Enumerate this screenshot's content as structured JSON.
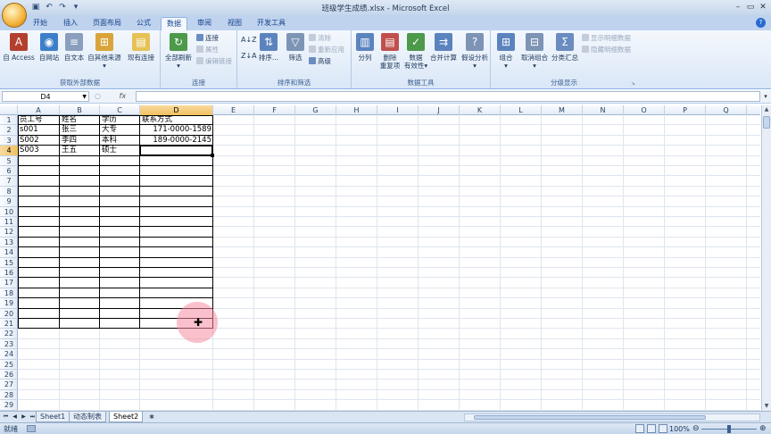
{
  "window": {
    "title": "班级学生成绩.xlsx - Microsoft Excel",
    "app_icon_letter": "X"
  },
  "ribbon_tabs": [
    "开始",
    "插入",
    "页面布局",
    "公式",
    "数据",
    "审阅",
    "视图",
    "开发工具"
  ],
  "active_tab": "数据",
  "ribbon": {
    "get_external": {
      "label": "获取外部数据",
      "access": "自 Access",
      "web": "自网站",
      "text": "自文本",
      "other": "自其他来源",
      "existing": "现有连接"
    },
    "connections": {
      "label": "连接",
      "refresh_all": "全部刷新",
      "connections": "连接",
      "properties": "属性",
      "edit_links": "编辑链接"
    },
    "sort_filter": {
      "label": "排序和筛选",
      "sort": "排序...",
      "filter": "筛选",
      "clear": "清除",
      "reapply": "重新应用",
      "advanced": "高级"
    },
    "data_tools": {
      "label": "数据工具",
      "text_to_columns": "分列",
      "remove_dup_1": "删除",
      "remove_dup_2": "重复项",
      "validation_1": "数据",
      "validation_2": "有效性",
      "consolidate": "合并计算",
      "whatif": "假设分析"
    },
    "outline": {
      "label": "分级显示",
      "group": "组合",
      "ungroup": "取消组合",
      "subtotal": "分类汇总",
      "show_detail": "显示明细数据",
      "hide_detail": "隐藏明细数据"
    }
  },
  "formula_bar": {
    "name_box": "D4",
    "fx": "fx",
    "content": ""
  },
  "columns": [
    "A",
    "B",
    "C",
    "D",
    "E",
    "F",
    "G",
    "H",
    "I",
    "J",
    "K",
    "L",
    "M",
    "N",
    "O",
    "P",
    "Q",
    "R"
  ],
  "rows": [
    "1",
    "2",
    "3",
    "4",
    "5",
    "6",
    "7",
    "8",
    "9",
    "10",
    "11",
    "12",
    "13",
    "14",
    "15",
    "16",
    "17",
    "18",
    "19",
    "20",
    "21",
    "22",
    "23",
    "24",
    "25",
    "26",
    "27",
    "28",
    "29"
  ],
  "selected": {
    "col": "D",
    "row": "4"
  },
  "cells": {
    "header": [
      "员工号",
      "姓名",
      "学历",
      "联系方式"
    ],
    "r2": [
      "s001",
      "张三",
      "大专",
      "171-0000-1589"
    ],
    "r3": [
      "S002",
      "李四",
      "本科",
      "189-0000-2145"
    ],
    "r4": [
      "S003",
      "王五",
      "硕士",
      ""
    ]
  },
  "sheets": [
    "Sheet1",
    "动态制表",
    "Sheet2"
  ],
  "active_sheet": "Sheet2",
  "status": {
    "ready": "就绪",
    "zoom": "100%"
  }
}
